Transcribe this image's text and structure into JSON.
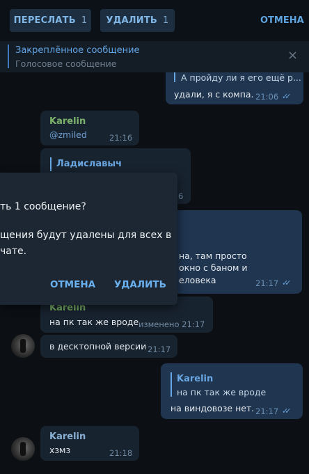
{
  "toolbar": {
    "forward_label": "ПЕРЕСЛАТЬ",
    "forward_count": "1",
    "delete_label": "УДАЛИТЬ",
    "delete_count": "1",
    "cancel_label": "ОТМЕНА"
  },
  "pinned": {
    "title": "Закреплённое сообщение",
    "subtitle": "Голосовое сообщение",
    "close_icon": "×"
  },
  "messages": {
    "m1": {
      "quote": "А пройду ли я его ещё р...",
      "text": "удали, я с компа.",
      "time": "21:06"
    },
    "m2": {
      "name": "Karelin",
      "text": "@zmiled",
      "time": "21:16"
    },
    "m3": {
      "quote_name": "Ладиславыч",
      "time_fragment": "6"
    },
    "m4": {
      "line1": "на, там просто",
      "line2": "окно с баном и",
      "line3": "еловека",
      "time": "21:17"
    },
    "m5": {
      "name": "Karelin",
      "text": "на пк так же вроде",
      "edited": "изменено 21:17"
    },
    "m6": {
      "text": "в десктопной версии",
      "time": "21:17"
    },
    "m7": {
      "quote_name": "Karelin",
      "quote_text": "на пк так же вроде",
      "text": "на виндовозе нет.",
      "time": "21:17"
    },
    "m8": {
      "name": "Karelin",
      "text": "хзмз",
      "time": "21:18"
    }
  },
  "dialog": {
    "title": "ть 1 сообщение?",
    "body_line1": "щения будут удалены для всех в",
    "body_line2": "чате.",
    "cancel_label": "ОТМЕНА",
    "delete_label": "УДАЛИТЬ"
  },
  "colors": {
    "accent": "#5da4e0",
    "name_green": "#7cb36a",
    "outgoing_bubble": "#2b5278",
    "incoming_bubble": "#182330"
  }
}
